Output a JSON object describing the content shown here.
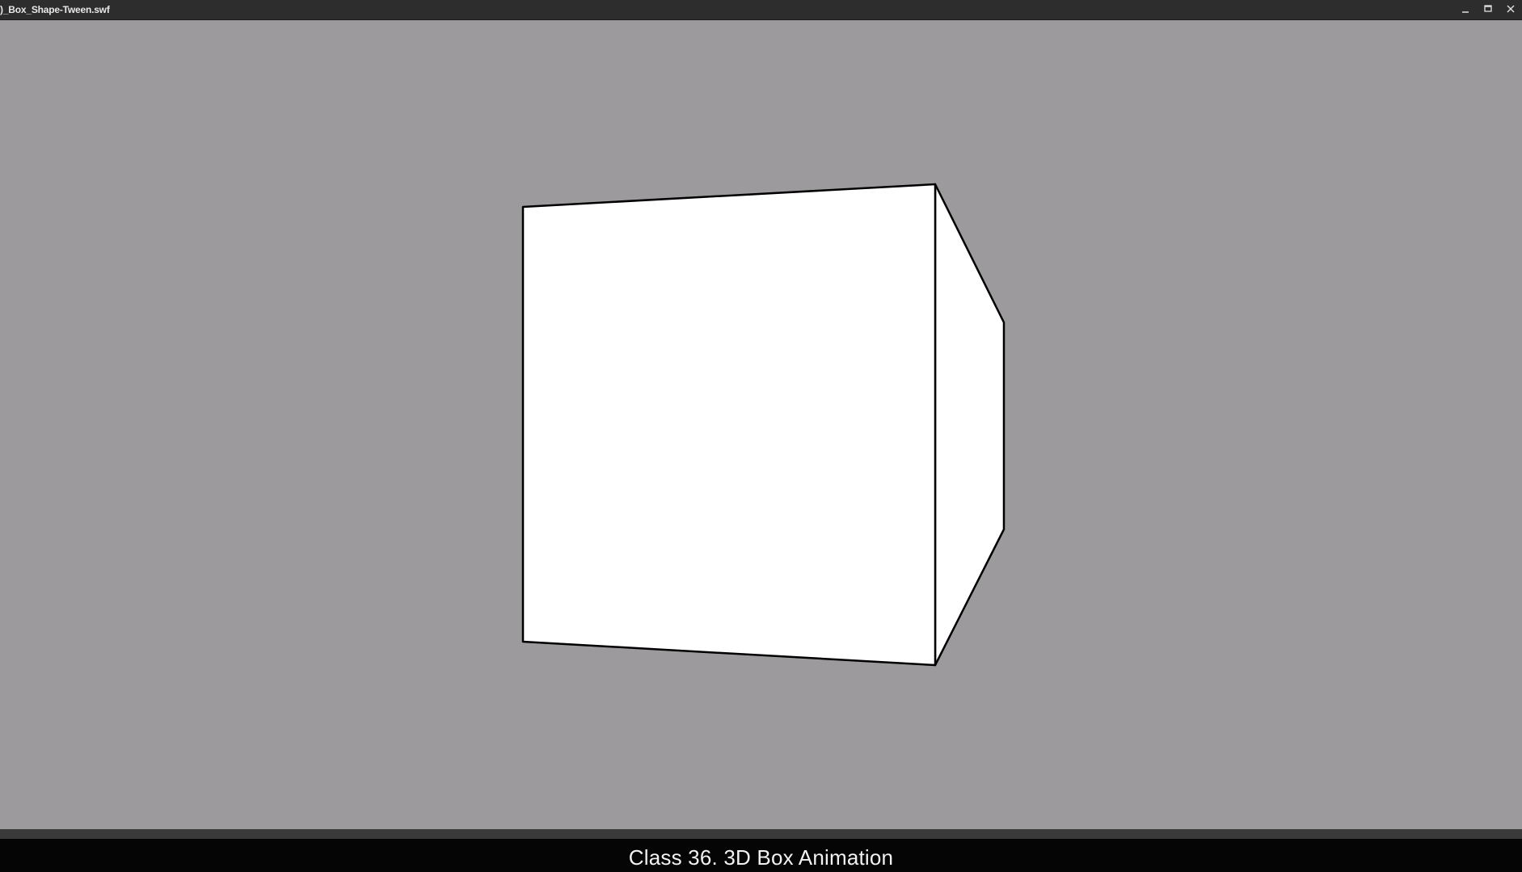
{
  "window": {
    "title": ")_Box_Shape-Tween.swf",
    "controls": {
      "minimize": "minimize-icon",
      "maximize": "maximize-icon",
      "close": "close-icon"
    }
  },
  "stage": {
    "background_color": "#9c9a9c",
    "box_fill": "#ffffff",
    "box_stroke": "#000000"
  },
  "caption": {
    "text": "Class 36. 3D Box Animation"
  }
}
